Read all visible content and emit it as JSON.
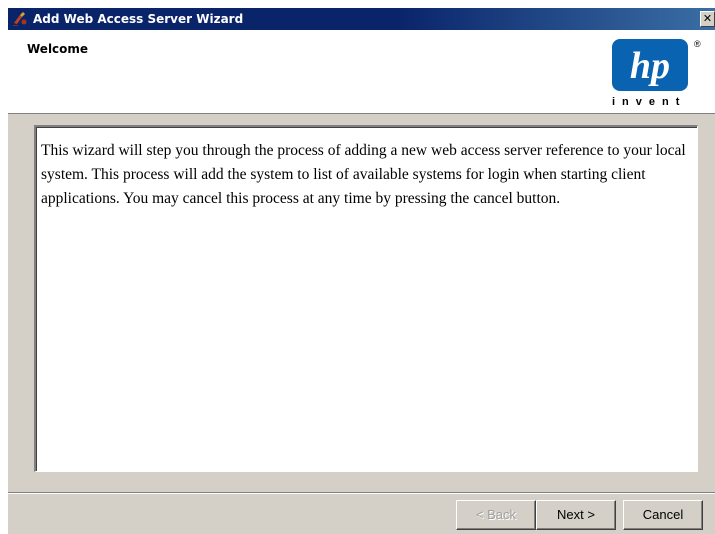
{
  "window": {
    "title": "Add Web Access Server Wizard",
    "close_glyph": "✕",
    "icon": "wizard-app-icon"
  },
  "header": {
    "title": "Welcome",
    "logo": {
      "text": "hp",
      "tagline": "invent",
      "registered": "®",
      "color": "#0a63b0"
    }
  },
  "content": {
    "text": "This wizard will step you through the process of adding a new web access server reference to your local system. This process will add the system to list of available systems for login when starting client applications. You may cancel this process at any time by pressing the cancel button."
  },
  "buttons": {
    "back": {
      "label": "< Back",
      "enabled": false
    },
    "next": {
      "label": "Next >",
      "enabled": true
    },
    "cancel": {
      "label": "Cancel",
      "enabled": true
    }
  },
  "colors": {
    "titlebar": "#0a246a",
    "dialog": "#d4d0c8"
  }
}
